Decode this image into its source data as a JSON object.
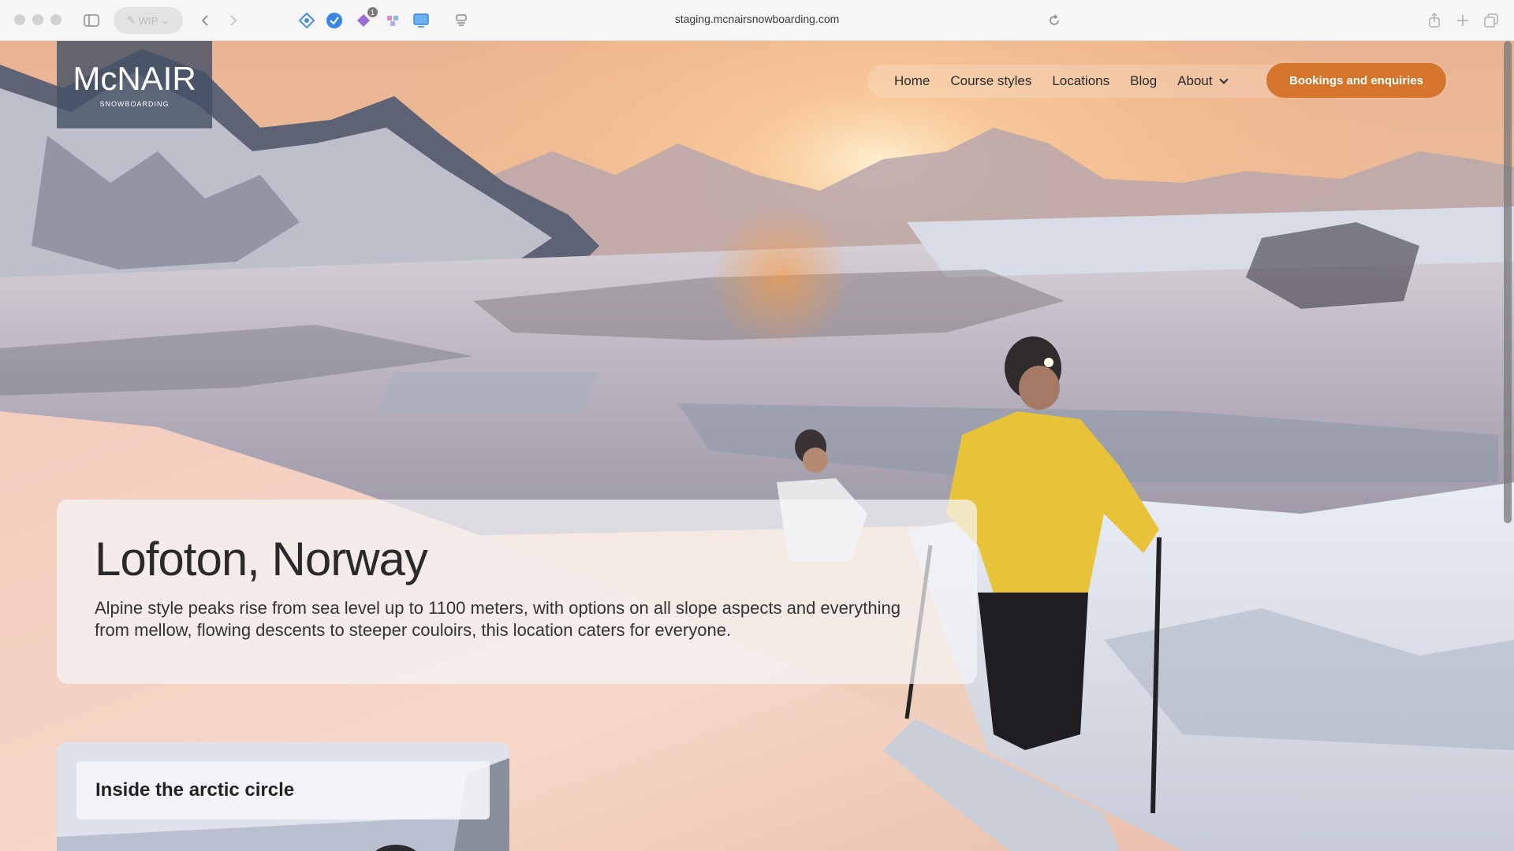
{
  "browser": {
    "url": "staging.mcnairsnowboarding.com",
    "profile_label": "WIP",
    "extension_badge": "1",
    "icons": [
      "sidebar-toggle-icon",
      "back-icon",
      "forward-icon",
      "reload-icon",
      "share-icon",
      "new-tab-icon",
      "tab-overview-icon",
      "reader-icon"
    ]
  },
  "site": {
    "logo_main": "McNAIR",
    "logo_sub": "SNOWBOARDING",
    "nav": [
      {
        "label": "Home"
      },
      {
        "label": "Course styles"
      },
      {
        "label": "Locations"
      },
      {
        "label": "Blog"
      },
      {
        "label": "About"
      }
    ],
    "cta": "Bookings and enquiries"
  },
  "hero": {
    "title": "Lofoton, Norway",
    "description": "Alpine style peaks rise from sea level up to 1100 meters, with options on all slope aspects and everything from mellow, flowing descents to steeper couloirs, this location caters for everyone."
  },
  "card": {
    "title": "Inside the arctic circle"
  },
  "colors": {
    "accent": "#d4752b",
    "logo_bg": "#465266"
  }
}
